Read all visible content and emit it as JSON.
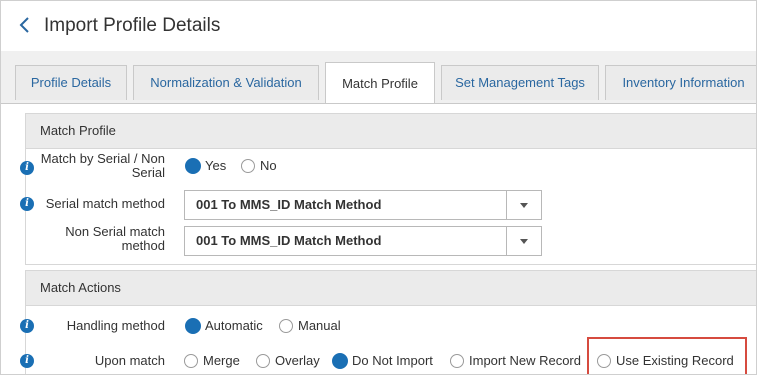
{
  "header": {
    "title": "Import Profile Details"
  },
  "tabs": [
    {
      "label": "Profile Details"
    },
    {
      "label": "Normalization & Validation"
    },
    {
      "label": "Match Profile"
    },
    {
      "label": "Set Management Tags"
    },
    {
      "label": "Inventory Information"
    }
  ],
  "active_tab": "Match Profile",
  "match_profile": {
    "section_title": "Match Profile",
    "serial_non_serial": {
      "label_line1": "Match by Serial / Non",
      "label_line2": "Serial",
      "options": [
        "Yes",
        "No"
      ],
      "selected": "Yes"
    },
    "serial_match_method": {
      "label": "Serial match method",
      "value": "001 To MMS_ID Match Method"
    },
    "non_serial_match_method": {
      "label_line1": "Non Serial match",
      "label_line2": "method",
      "value": "001 To MMS_ID Match Method"
    }
  },
  "match_actions": {
    "section_title": "Match Actions",
    "handling_method": {
      "label": "Handling method",
      "options": [
        "Automatic",
        "Manual"
      ],
      "selected": "Automatic"
    },
    "upon_match": {
      "label": "Upon match",
      "options": [
        "Merge",
        "Overlay",
        "Do Not Import",
        "Import New Record",
        "Use Existing Record"
      ],
      "selected": "Do Not Import"
    }
  },
  "colors": {
    "accent": "#1a6fb4",
    "highlight": "#d64b3f",
    "link": "#2a67a0"
  }
}
